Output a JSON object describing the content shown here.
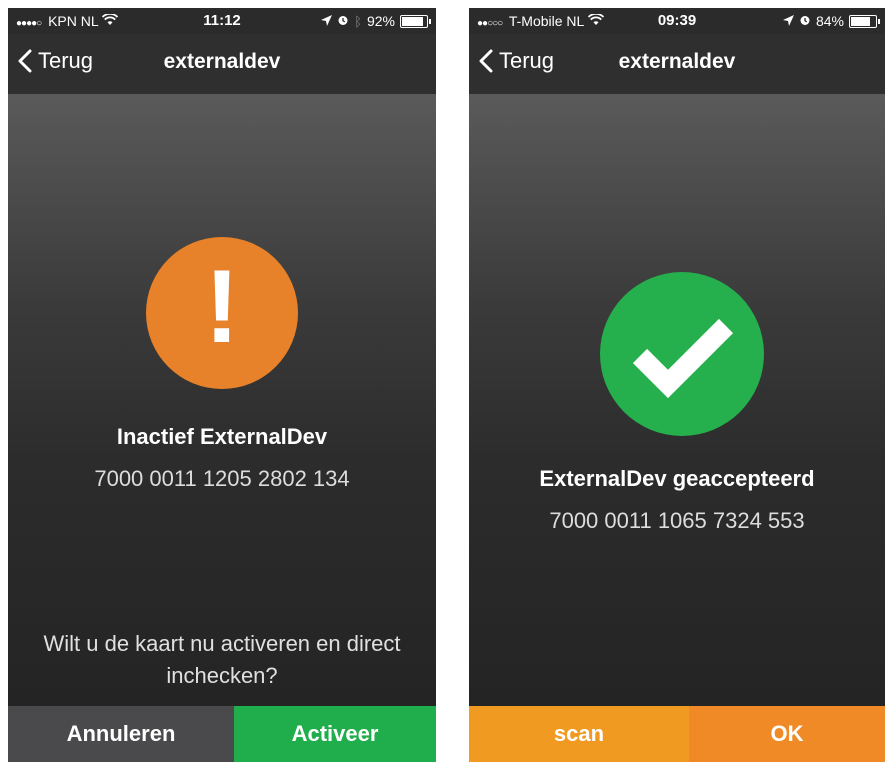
{
  "left_phone": {
    "status": {
      "carrier": "KPN NL",
      "time": "11:12",
      "battery": "92%",
      "battery_level": 0.92
    },
    "nav": {
      "back_label": "Terug",
      "title": "externaldev"
    },
    "alert": {
      "symbol": "!",
      "color": "#e8822a"
    },
    "headline": "Inactief ExternalDev",
    "card_number": "7000 0011 1205 2802 134",
    "question": "Wilt u de kaart nu activeren en direct inchecken?",
    "buttons": {
      "cancel": "Annuleren",
      "activate": "Activeer"
    },
    "colors": {
      "cancel_bg": "#4a4a4c",
      "activate_bg": "#1fae4b"
    }
  },
  "right_phone": {
    "status": {
      "carrier": "T-Mobile NL",
      "time": "09:39",
      "battery": "84%",
      "battery_level": 0.84
    },
    "nav": {
      "back_label": "Terug",
      "title": "externaldev"
    },
    "check": {
      "color": "#25b04d"
    },
    "headline": "ExternalDev geaccepteerd",
    "card_number": "7000 0011 1065 7324 553",
    "buttons": {
      "scan": "scan",
      "ok": "OK"
    },
    "colors": {
      "scan_bg": "#f09a22",
      "ok_bg": "#ef8a26"
    }
  }
}
